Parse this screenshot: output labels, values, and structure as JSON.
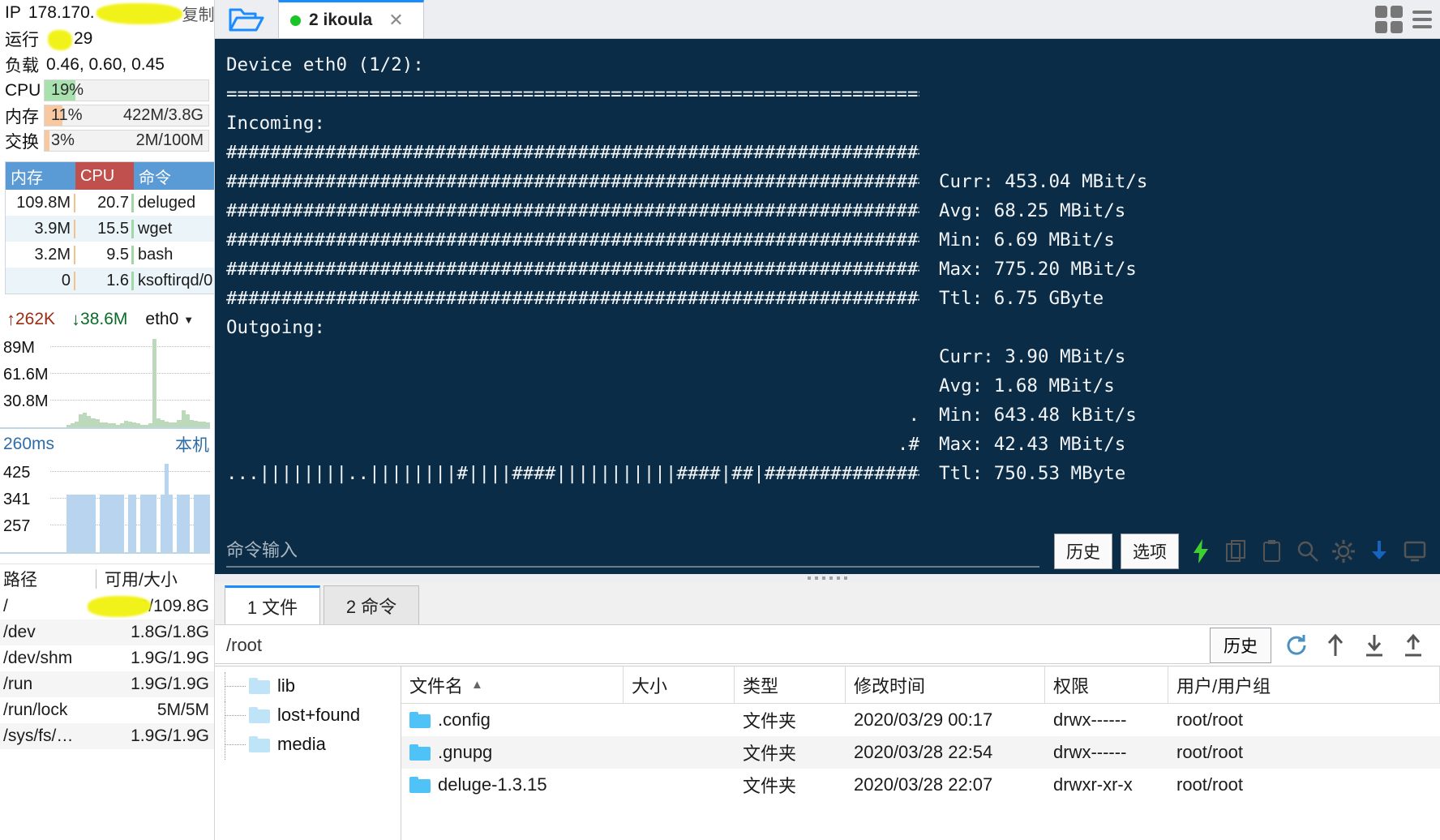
{
  "sidebar": {
    "ip": {
      "label": "IP",
      "value": "178.170.",
      "redacted": true,
      "copy_label": "复制"
    },
    "uptime": {
      "label": "运行",
      "value": "29"
    },
    "load": {
      "label": "负载",
      "value": "0.46, 0.60, 0.45"
    },
    "cpu": {
      "label": "CPU",
      "pct": "19%",
      "fill": 19,
      "color": "#a8e0ae"
    },
    "mem": {
      "label": "内存",
      "pct": "11%",
      "fill": 11,
      "extra": "422M/3.8G",
      "color": "#f8c9a0"
    },
    "swap": {
      "label": "交换",
      "pct": "3%",
      "fill": 3,
      "extra": "2M/100M",
      "color": "#f8c9a0"
    },
    "proc_table": {
      "headers": [
        "内存",
        "CPU",
        "命令"
      ],
      "rows": [
        {
          "mem": "109.8M",
          "cpu": "20.7",
          "cmd": "deluged"
        },
        {
          "mem": "3.9M",
          "cpu": "15.5",
          "cmd": "wget"
        },
        {
          "mem": "3.2M",
          "cpu": "9.5",
          "cmd": "bash"
        },
        {
          "mem": "0",
          "cpu": "1.6",
          "cmd": "ksoftirqd/0"
        }
      ]
    },
    "net": {
      "up": "262K",
      "down": "38.6M",
      "iface": "eth0",
      "y_labels": [
        "89M",
        "61.6M",
        "30.8M"
      ]
    },
    "latency": {
      "value": "260ms",
      "target": "本机",
      "y_labels": [
        "425",
        "341",
        "257"
      ]
    },
    "disk": {
      "headers": [
        "路径",
        "可用/大小"
      ],
      "rows": [
        {
          "path": "/",
          "size": "G/109.8G",
          "redacted": true
        },
        {
          "path": "/dev",
          "size": "1.8G/1.8G"
        },
        {
          "path": "/dev/shm",
          "size": "1.9G/1.9G"
        },
        {
          "path": "/run",
          "size": "1.9G/1.9G"
        },
        {
          "path": "/run/lock",
          "size": "5M/5M"
        },
        {
          "path": "/sys/fs/…",
          "size": "1.9G/1.9G"
        }
      ]
    }
  },
  "tabstrip": {
    "folder_icon": "open-folder-icon",
    "tabs": [
      {
        "label": "2 ikoula",
        "status": "connected",
        "close": "✕"
      }
    ],
    "grid_icon": "grid-view-icon",
    "menu_icon": "hamburger-menu-icon"
  },
  "terminal": {
    "title": "Device eth0 (1/2):",
    "separator": "=================================================================================",
    "incoming_label": "Incoming:",
    "outgoing_label": "Outgoing:",
    "incoming_bars": [
      "#################################################################",
      "#################################################################",
      "#################################################################",
      "#################################################################",
      "#################################################################",
      "#################################################################"
    ],
    "incoming_stats": [
      "Curr: 453.04 MBit/s",
      "Avg: 68.25 MBit/s",
      "Min: 6.69 MBit/s",
      "Max: 775.20 MBit/s",
      "Ttl: 6.75 GByte"
    ],
    "outgoing_rows": [
      {
        "gfx": "",
        "stat": ""
      },
      {
        "gfx": "",
        "stat": "Curr: 3.90 MBit/s"
      },
      {
        "gfx": "",
        "stat": "Avg: 1.68 MBit/s"
      },
      {
        "gfx": ".",
        "stat": "Min: 643.48 kBit/s"
      },
      {
        "gfx": ".#",
        "stat": "Max: 42.43 MBit/s"
      },
      {
        "gfx": "...||||||||..||||||||#||||####|||||||||||####|##|###############",
        "stat": "Ttl: 750.53 MByte"
      }
    ],
    "command_placeholder": "命令输入",
    "history_button": "历史",
    "options_button": "选项",
    "icons": [
      "lightning-icon",
      "copy-icon",
      "paste-icon",
      "search-icon",
      "gear-icon",
      "download-icon",
      "monitor-icon"
    ]
  },
  "filepanel": {
    "tabs": [
      {
        "label": "1 文件",
        "active": true
      },
      {
        "label": "2 命令",
        "active": false
      }
    ],
    "path": "/root",
    "history_button": "历史",
    "toolbar_icons": [
      "refresh-icon",
      "up-arrow-icon",
      "download-icon",
      "upload-icon"
    ],
    "tree": [
      {
        "label": "lib"
      },
      {
        "label": "lost+found"
      },
      {
        "label": "media"
      }
    ],
    "columns": [
      "文件名",
      "大小",
      "类型",
      "修改时间",
      "权限",
      "用户/用户组"
    ],
    "sort_column": "文件名",
    "sort_dir": "▲",
    "rows": [
      {
        "name": ".config",
        "size": "",
        "type": "文件夹",
        "mtime": "2020/03/29 00:17",
        "perm": "drwx------",
        "user": "root/root"
      },
      {
        "name": ".gnupg",
        "size": "",
        "type": "文件夹",
        "mtime": "2020/03/28 22:54",
        "perm": "drwx------",
        "user": "root/root"
      },
      {
        "name": "deluge-1.3.15",
        "size": "",
        "type": "文件夹",
        "mtime": "2020/03/28 22:07",
        "perm": "drwxr-xr-x",
        "user": "root/root"
      }
    ]
  }
}
